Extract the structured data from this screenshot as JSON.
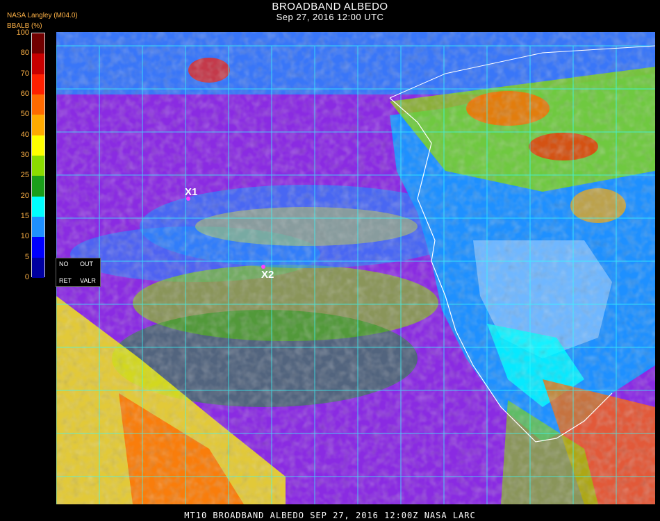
{
  "header": {
    "title": "BROADBAND ALBEDO",
    "datetime": "Sep 27, 2016 12:00 UTC",
    "source": "NASA Langley (M04.0)",
    "units_label": "BBALB (%)"
  },
  "colorbar": {
    "ticks": [
      "100",
      "80",
      "70",
      "60",
      "50",
      "40",
      "30",
      "25",
      "20",
      "15",
      "10",
      "5",
      "0"
    ],
    "colors": [
      "#700000",
      "#c80000",
      "#ff2000",
      "#ff6a00",
      "#ffaa00",
      "#ffff00",
      "#8bdc00",
      "#1a9e1a",
      "#00ffff",
      "#1e90ff",
      "#0000ff",
      "#0000a0",
      "#8a2be2"
    ]
  },
  "legend_box": {
    "no_label": "NO",
    "out_label": "OUT",
    "ret_label": "RET",
    "valr_label": "VALR"
  },
  "markers": [
    {
      "label": "X1"
    },
    {
      "label": "X2"
    }
  ],
  "footer": {
    "text": "MT10  BROADBAND ALBEDO   SEP 27, 2016 12:00Z   NASA LARC"
  }
}
